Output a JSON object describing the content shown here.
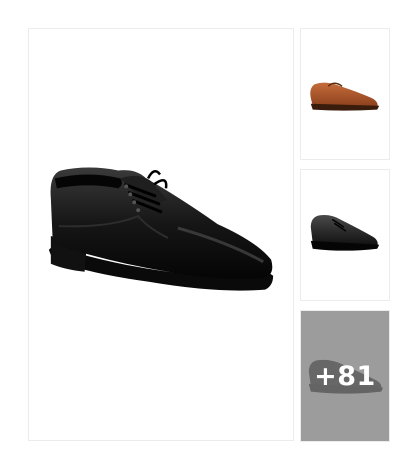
{
  "gallery": {
    "main_image": {
      "icon": "black-formal-derby-shoe",
      "color": "#151515"
    },
    "thumbnails": [
      {
        "icon": "tan-formal-shoe",
        "color": "#a8552a"
      },
      {
        "icon": "black-derby-shoe",
        "color": "#1c1c1c"
      },
      {
        "icon": "black-slip-on-shoe",
        "color": "#121212"
      }
    ],
    "more_overlay": {
      "label": "+81",
      "background": "#8a8a8a"
    }
  }
}
